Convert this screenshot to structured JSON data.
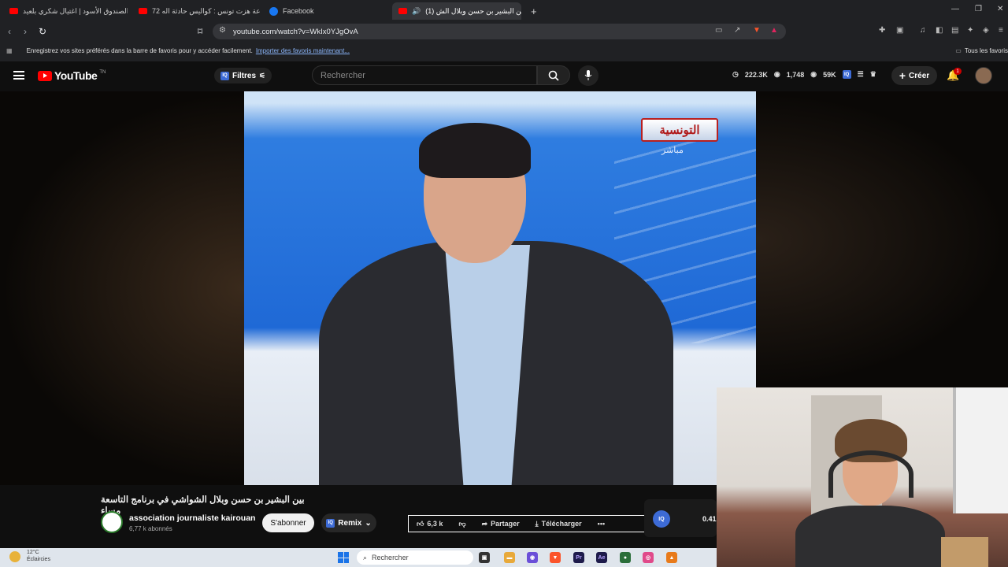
{
  "browser": {
    "tabs": [
      {
        "title": "الصندوق الأسود | اغتيال شكري بلعيد..."
      },
      {
        "title": "72 ساعة هزت تونس : كواليس حادثة اله..."
      },
      {
        "title": "Facebook"
      },
      {
        "title": "(1) بين البشير بن حسن وبلال الش..."
      }
    ],
    "url": "youtube.com/watch?v=WkIx0YJgOvA",
    "bookmarks_prompt": "Enregistrez vos sites préférés dans la barre de favoris pour y accéder facilement.",
    "bookmarks_link": "Importer des favoris maintenant...",
    "all_favorites": "Tous les favoris"
  },
  "youtube": {
    "logo": "YouTube",
    "logo_country": "TN",
    "filters_label": "Filtres",
    "search_placeholder": "Rechercher",
    "stats": {
      "a": "222.3K",
      "b": "1,748",
      "c": "59K"
    },
    "create_label": "Créer",
    "notification_count": "1"
  },
  "video": {
    "channel_logo_text": "التونسية",
    "channel_logo_sub": "مباشر",
    "title": "بين البشير بن حسن وبلال الشواشي في برنامج التاسعة مساء",
    "channel_name": "association journaliste kairouan",
    "subscribers": "6,77 k abonnés",
    "subscribe_label": "S'abonner",
    "remix_label": "Remix",
    "likes": "6,3 k",
    "share_label": "Partager",
    "download_label": "Télécharger",
    "iq_label": "IQ",
    "side_value": "0.41"
  },
  "taskbar": {
    "temperature": "12°C",
    "weather": "Éclaircies",
    "search_label": "Rechercher"
  },
  "colors": {
    "yt_red": "#ff0000",
    "accent_blue": "#3d6bd6",
    "browser_bg": "#202124"
  }
}
